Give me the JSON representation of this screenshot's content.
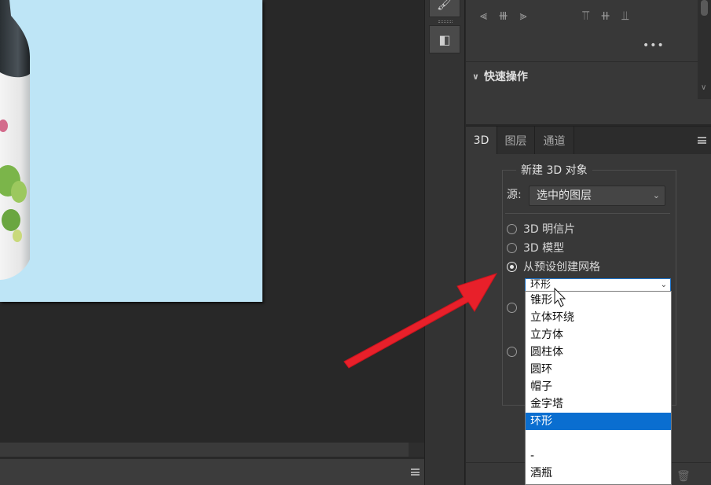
{
  "canvas": {
    "status_menu_icon": "hamburger-icon"
  },
  "toolstrip": {
    "tools": [
      {
        "icon": "brush-tool-icon",
        "glyph": "🖌"
      },
      {
        "icon": "panel-toggle-icon",
        "glyph": "◧"
      }
    ]
  },
  "align_panel": {
    "left_group": [
      "⫷",
      "⧻",
      "⫸"
    ],
    "right_group": [
      "⫪",
      "⧺",
      "⫫"
    ],
    "more_label": "•••"
  },
  "quick_actions": {
    "title": "快速操作",
    "chevron": "∨"
  },
  "tabs": [
    {
      "label": "3D",
      "active": true
    },
    {
      "label": "图层",
      "active": false
    },
    {
      "label": "通道",
      "active": false
    }
  ],
  "panel_3d": {
    "group_title": "新建 3D 对象",
    "source_label": "源:",
    "source_value": "选中的图层",
    "options": [
      {
        "label": "3D 明信片",
        "checked": false
      },
      {
        "label": "3D 模型",
        "checked": false
      },
      {
        "label": "从预设创建网格",
        "checked": true
      }
    ]
  },
  "dropdown": {
    "current": "环形",
    "items": [
      "锥形",
      "立体环绕",
      "立方体",
      "圆柱体",
      "圆环",
      "帽子",
      "金字塔",
      "环形",
      "",
      "-",
      "酒瓶"
    ],
    "selected_index": 7
  },
  "colors": {
    "accent": "#0a6ed0",
    "arrow": "#e8202a",
    "canvas_bg": "#bee5f6"
  }
}
